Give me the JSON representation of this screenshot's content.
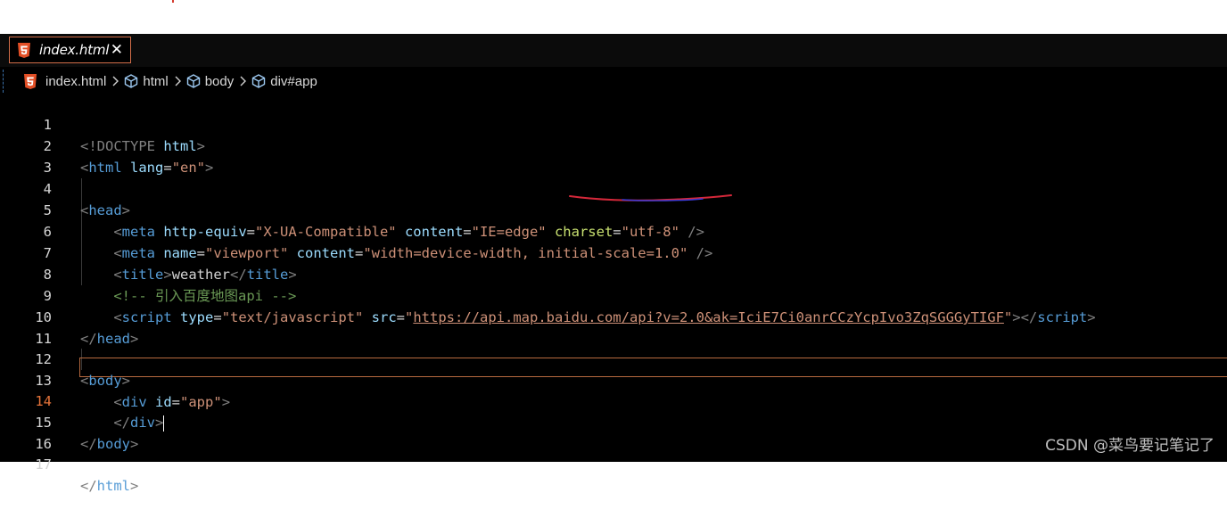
{
  "tab": {
    "label": "index.html",
    "close": "✕"
  },
  "breadcrumb": [
    "index.html",
    "html",
    "body",
    "div#app"
  ],
  "editor": {
    "active_line": 14,
    "line_numbers": [
      "1",
      "2",
      "3",
      "4",
      "5",
      "6",
      "7",
      "8",
      "9",
      "10",
      "11",
      "12",
      "13",
      "14",
      "15",
      "16",
      "17"
    ],
    "lines": {
      "l1": {
        "a": "<!DOCTYPE",
        "b": " html",
        "c": ">"
      },
      "l2": {
        "open": "<",
        "tag": "html",
        "attr": " lang",
        "eq": "=",
        "val": "\"en\"",
        "close": ">"
      },
      "l4": {
        "open": "<",
        "tag": "head",
        "close": ">"
      },
      "l5": {
        "indent": "    ",
        "open": "<",
        "tag": "meta",
        "a1": " http-equiv",
        "v1": "\"X-UA-Compatible\"",
        "a2": " content",
        "v2": "\"IE=edge\"",
        "a3": " charset",
        "v3": "\"utf-8\"",
        "end": " />"
      },
      "l6": {
        "indent": "    ",
        "open": "<",
        "tag": "meta",
        "a1": " name",
        "v1": "\"viewport\"",
        "a2": " content",
        "v2": "\"width=device-width, initial-scale=1.0\"",
        "end": " />"
      },
      "l7": {
        "indent": "    ",
        "o1": "<",
        "tag": "title",
        "c1": ">",
        "text": "weather",
        "o2": "</",
        "tag2": "title",
        "c2": ">"
      },
      "l8": {
        "indent": "    ",
        "comment": "<!-- 引入百度地图api -->"
      },
      "l9": {
        "indent": "    ",
        "open": "<",
        "tag": "script",
        "a1": " type",
        "v1": "\"text/javascript\"",
        "a2": " src",
        "q1": "\"",
        "url": "https://api.map.baidu.com/api?v=2.0&ak=IciE7Ci0anrCCzYcpIvo3ZqSGGGyTIGF",
        "q2": "\"",
        "c1": ">",
        "o2": "</",
        "tag2": "script",
        "c2": ">"
      },
      "l10": {
        "open": "</",
        "tag": "head",
        "close": ">"
      },
      "l12": {
        "open": "<",
        "tag": "body",
        "close": ">"
      },
      "l13": {
        "indent": "    ",
        "open": "<",
        "tag": "div",
        "attr": " id",
        "eq": "=",
        "val": "\"app\"",
        "close": ">"
      },
      "l14": {
        "indent": "    ",
        "open": "</",
        "tag": "div",
        "close": ">"
      },
      "l15": {
        "open": "</",
        "tag": "body",
        "close": ">"
      },
      "l17": {
        "open": "</",
        "tag": "html",
        "close": ">"
      }
    }
  },
  "watermark": "CSDN @菜鸟要记笔记了",
  "colors": {
    "tag": "#569cd6",
    "attr": "#9cdcfe",
    "string": "#ce9178",
    "comment": "#6a9955",
    "tab_border": "#d26e49",
    "annotation": "#d4283a"
  }
}
